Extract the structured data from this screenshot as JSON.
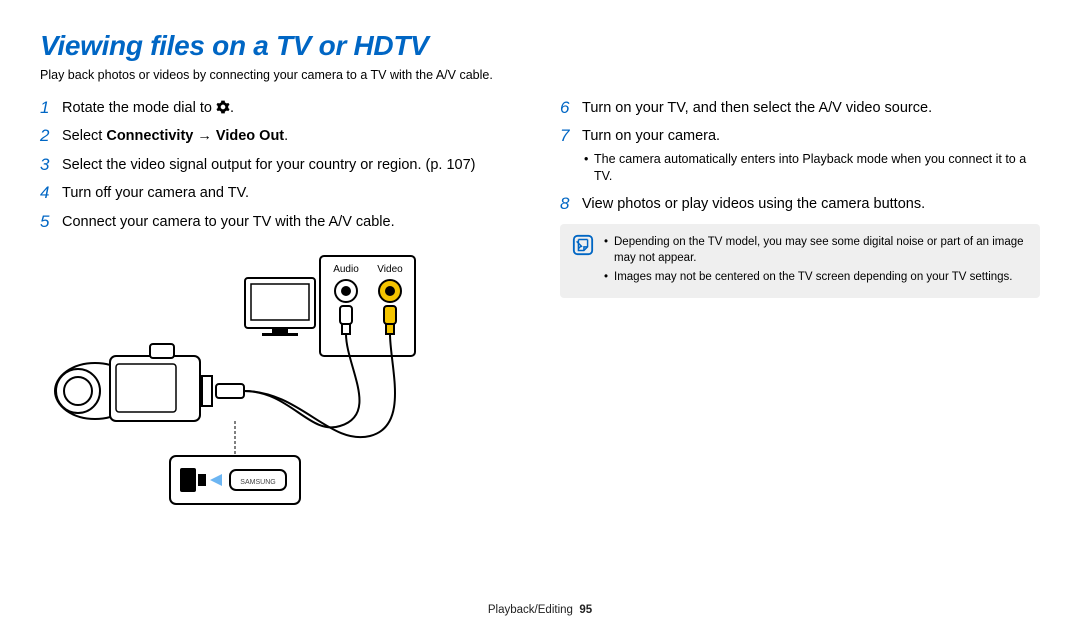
{
  "title": "Viewing files on a TV or HDTV",
  "subtitle": "Play back photos or videos by connecting your camera to a TV with the A/V cable.",
  "left_steps": [
    {
      "num": "1",
      "pre": "Rotate the mode dial to ",
      "icon": "gear",
      "post": "."
    },
    {
      "num": "2",
      "pre": "Select ",
      "bold1": "Connectivity",
      "mid": " → ",
      "bold2": "Video Out",
      "post2": "."
    },
    {
      "num": "3",
      "text": "Select the video signal output for your country or region. (p. 107)"
    },
    {
      "num": "4",
      "text": "Turn off your camera and TV."
    },
    {
      "num": "5",
      "text": "Connect your camera to your TV with the A/V cable."
    }
  ],
  "diagram_labels": {
    "audio": "Audio",
    "video": "Video"
  },
  "right_steps": [
    {
      "num": "6",
      "text": "Turn on your TV, and then select the A/V video source."
    },
    {
      "num": "7",
      "text": "Turn on your camera.",
      "sub": [
        "The camera automatically enters into Playback mode when you connect it to a TV."
      ]
    },
    {
      "num": "8",
      "text": "View photos or play videos using the camera buttons."
    }
  ],
  "note": [
    "Depending on the TV model, you may see some digital noise or part of an image may not appear.",
    "Images may not be centered on the TV screen depending on your TV settings."
  ],
  "footer_section": "Playback/Editing",
  "footer_page": "95"
}
